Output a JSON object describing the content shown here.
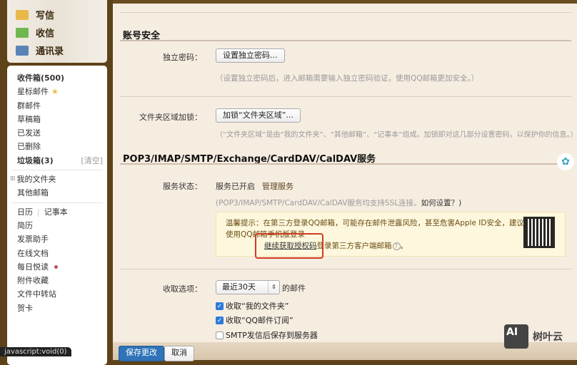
{
  "sidebar": {
    "top": [
      {
        "label": "写信",
        "icon": "compose-icon"
      },
      {
        "label": "收信",
        "icon": "inbox-download-icon"
      },
      {
        "label": "通讯录",
        "icon": "contacts-icon"
      }
    ],
    "inbox": "收件箱(500)",
    "starred": "星标邮件",
    "group": "群邮件",
    "drafts": "草稿箱",
    "sent": "已发送",
    "deleted": "已删除",
    "trash": "垃圾箱(3)",
    "trash_clear": "[清空]",
    "my_folders": "我的文件夹",
    "other_mailboxes": "其他邮箱",
    "calendar": "日历",
    "notes": "记事本",
    "resume": "简历",
    "invoice": "发票助手",
    "docs": "在线文档",
    "daily_read": "每日悦读",
    "attachments": "附件收藏",
    "file_transfer": "文件中转站",
    "cards": "贺卡"
  },
  "account": {
    "title": "账号安全",
    "pw_label": "独立密码：",
    "pw_button": "设置独立密码...",
    "pw_hint": "（设置独立密码后，进入邮箱需要输入独立密码验证，使用QQ邮箱更加安全。）",
    "lock_label": "文件夹区域加锁：",
    "lock_button": "加锁“文件夹区域”...",
    "lock_hint": "（“文件夹区域”是由“我的文件夹”、“其他邮箱”、“记事本”组成。加锁即对这几部分设置密码，以保护你的信息。）"
  },
  "pop": {
    "title": "POP3/IMAP/SMTP/Exchange/CardDAV/CalDAV服务",
    "status_label": "服务状态：",
    "status": "服务已开启",
    "manage": "管理服务",
    "ssl_hint": "(POP3/IMAP/SMTP/CardDAV/CalDAV服务均支持SSL连接。",
    "how": "如何设置？)",
    "tip": "温馨提示：在第三方登录QQ邮箱，可能存在邮件泄露风险，甚至危害Apple ID安全，建议使用QQ邮箱手机版登录",
    "auth_link": "继续获取授权码",
    "auth_rest": "登录第三方客户端邮箱",
    "period": "。"
  },
  "fetch": {
    "label": "收取选项：",
    "select": "最近30天",
    "suffix": "的邮件",
    "options": [
      {
        "label": "收取“我的文件夹”",
        "checked": true
      },
      {
        "label": "收取“QQ邮件订阅”",
        "checked": true
      },
      {
        "label": "SMTP发信后保存到服务器",
        "checked": false
      }
    ]
  },
  "footer": {
    "save": "保存更改",
    "cancel": "取消"
  },
  "statusbar": "javascript:void(0)",
  "watermark": {
    "logo": "AI",
    "text": "树叶云"
  }
}
